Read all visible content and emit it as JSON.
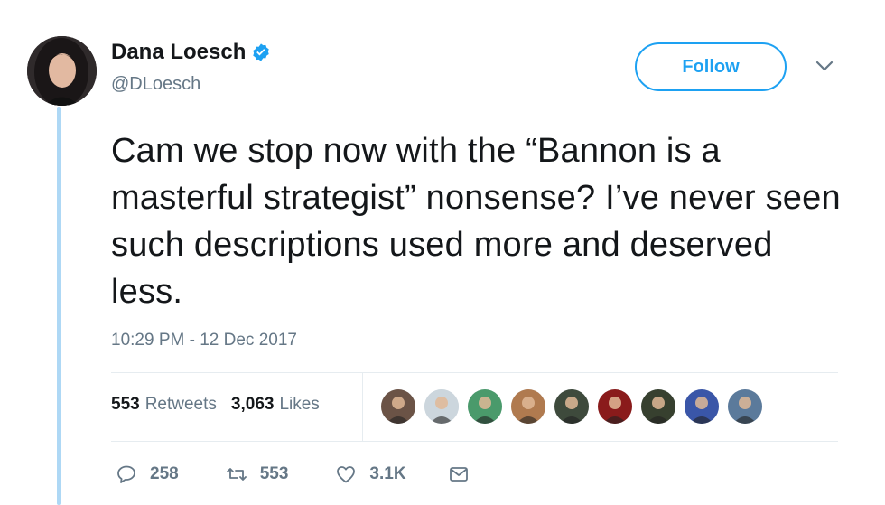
{
  "author": {
    "name": "Dana Loesch",
    "handle": "@DLoesch",
    "verified": true
  },
  "follow_button": {
    "label": "Follow"
  },
  "tweet": {
    "text": "Cam we stop now with the “Bannon is a masterful strategist” nonsense? I’ve never seen such descriptions used more and deserved less.",
    "timestamp": "10:29 PM - 12 Dec 2017"
  },
  "stats": {
    "retweets_count": "553",
    "retweets_label": "Retweets",
    "likes_count": "3,063",
    "likes_label": "Likes"
  },
  "likers": [
    {
      "color": "#6b5346"
    },
    {
      "color": "#ccd6dd"
    },
    {
      "color": "#4a9a6b"
    },
    {
      "color": "#b07a4f"
    },
    {
      "color": "#3e4a3c"
    },
    {
      "color": "#8a1b1b"
    },
    {
      "color": "#37402f"
    },
    {
      "color": "#3a56a8"
    },
    {
      "color": "#5b7a9b"
    }
  ],
  "actions": {
    "replies": "258",
    "retweets": "553",
    "likes": "3.1K"
  },
  "colors": {
    "accent": "#1da1f2",
    "muted": "#657786",
    "thread_line": "#aed8f5"
  }
}
